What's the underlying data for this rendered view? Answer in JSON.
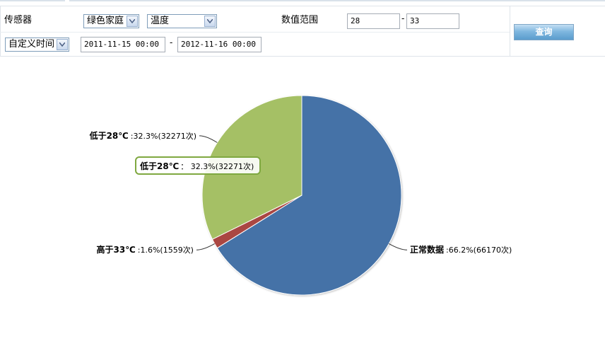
{
  "filter": {
    "sensor_label": "传感器",
    "sensor_value": "绿色家庭",
    "metric_value": "温度",
    "range_label": "数值范围",
    "range_min": "28",
    "range_sep": "-",
    "range_max": "33",
    "time_mode": "自定义时间",
    "time_start": "2011-11-15 00:00",
    "time_sep": "-",
    "time_end": "2012-11-16 00:00",
    "query_button": "查询"
  },
  "tooltip": {
    "name": "低于28℃",
    "text": "： 32.3%(32271次)"
  },
  "colors": {
    "normal": "#4572a7",
    "high": "#aa4643",
    "low": "#a5c065"
  },
  "chart_data": {
    "type": "pie",
    "series": [
      {
        "name": "正常数据",
        "percent": 66.2,
        "count": 66170,
        "label_text": ":66.2%(66170次)",
        "color": "#4572a7"
      },
      {
        "name": "高于33℃",
        "percent": 1.6,
        "count": 1559,
        "label_text": ":1.6%(1559次)",
        "color": "#aa4643"
      },
      {
        "name": "低于28℃",
        "percent": 32.3,
        "count": 32271,
        "label_text": ":32.3%(32271次)",
        "color": "#a5c065"
      }
    ]
  }
}
